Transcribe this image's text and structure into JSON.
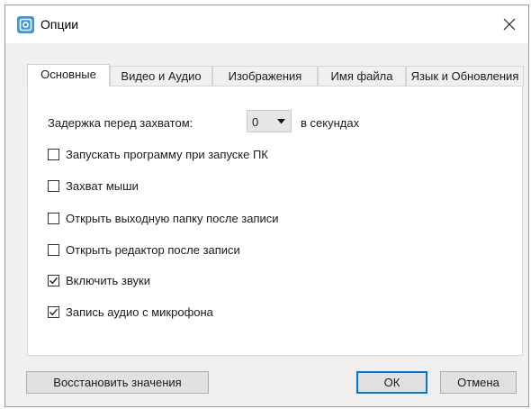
{
  "window": {
    "title": "Опции",
    "accent_color": "#0078d7",
    "icon_color": "#3a98e0"
  },
  "tabs": [
    {
      "label": "Основные",
      "active": true
    },
    {
      "label": "Видео и Аудио",
      "active": false
    },
    {
      "label": "Изображения",
      "active": false
    },
    {
      "label": "Имя файла",
      "active": false
    },
    {
      "label": "Язык и Обновления",
      "active": false
    }
  ],
  "delay": {
    "label": "Задержка перед захватом:",
    "value": "0",
    "unit": "в секундах"
  },
  "options": [
    {
      "label": "Запускать программу при запуске ПК",
      "checked": false
    },
    {
      "label": "Захват мыши",
      "checked": false
    },
    {
      "label": "Открыть выходную папку после записи",
      "checked": false
    },
    {
      "label": "Открыть редактор после записи",
      "checked": false
    },
    {
      "label": "Включить звуки",
      "checked": true
    },
    {
      "label": "Запись аудио с микрофона",
      "checked": true
    }
  ],
  "buttons": {
    "reset": "Восстановить значения",
    "ok": "ОК",
    "cancel": "Отмена"
  }
}
